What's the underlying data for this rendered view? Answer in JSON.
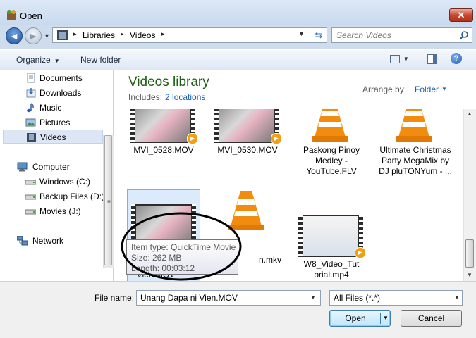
{
  "window": {
    "title": "Open",
    "close_glyph": "✕",
    "app_icon": "app-icon"
  },
  "nav": {
    "back_glyph": "◄",
    "forward_glyph": "►"
  },
  "address": {
    "crumbs": [
      "Libraries",
      "Videos"
    ],
    "separator": "▸"
  },
  "search": {
    "placeholder": "Search Videos"
  },
  "toolbar": {
    "organize": "Organize",
    "new_folder": "New folder"
  },
  "sidebar": {
    "items": [
      {
        "label": "Documents",
        "icon": "documents-icon"
      },
      {
        "label": "Downloads",
        "icon": "downloads-icon"
      },
      {
        "label": "Music",
        "icon": "music-icon"
      },
      {
        "label": "Pictures",
        "icon": "pictures-icon"
      },
      {
        "label": "Videos",
        "icon": "videos-icon",
        "selected": true
      },
      {
        "label": "Computer",
        "icon": "computer-icon"
      },
      {
        "label": "Windows (C:)",
        "icon": "drive-icon"
      },
      {
        "label": "Backup Files (D:)",
        "icon": "drive-icon"
      },
      {
        "label": "Movies (J:)",
        "icon": "drive-icon"
      },
      {
        "label": "Network",
        "icon": "network-icon"
      }
    ]
  },
  "library": {
    "title": "Videos library",
    "includes_label": "Includes:",
    "includes_link": "2 locations",
    "arrange_label": "Arrange by:",
    "arrange_value": "Folder"
  },
  "files": [
    {
      "name": "MVI_0528.MOV",
      "kind": "video"
    },
    {
      "name": "MVI_0530.MOV",
      "kind": "video"
    },
    {
      "name": "Paskong Pinoy Medley - YouTube.FLV",
      "kind": "vlc"
    },
    {
      "name": "Ultimate Christmas Party MegaMix by DJ pluTONYum - ...",
      "kind": "vlc"
    },
    {
      "name": "Vien.MOV",
      "kind": "video",
      "selected": true
    },
    {
      "name": "n.mkv",
      "kind": "vlc"
    },
    {
      "name": "W8_Video_Tutorial.mp4",
      "kind": "video"
    }
  ],
  "tooltip": {
    "type": "Item type: QuickTime Movie",
    "size": "Size: 262 MB",
    "length": "Length: 00:03:12"
  },
  "footer": {
    "file_name_label": "File name:",
    "file_name_value": "Unang Dapa ni Vien.MOV",
    "file_type": "All Files (*.*)",
    "open": "Open",
    "cancel": "Cancel"
  },
  "colors": {
    "title_green": "#1e5d13",
    "link_blue": "#1a5fb4",
    "vlc_orange": "#f28c0f"
  }
}
